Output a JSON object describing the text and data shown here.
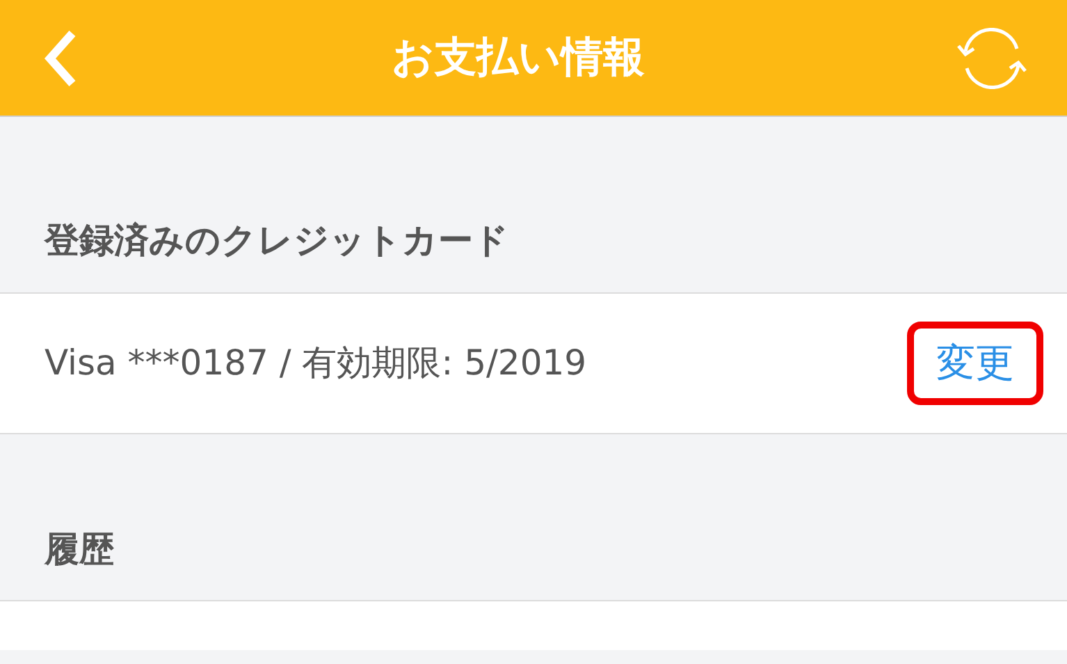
{
  "header": {
    "title": "お支払い情報"
  },
  "sections": [
    {
      "heading": "登録済みのクレジットカード",
      "rows": [
        {
          "text": "Visa ***0187 / 有効期限: 5/2019",
          "action": "変更",
          "highlighted": true
        }
      ]
    },
    {
      "heading": "履歴"
    }
  ]
}
